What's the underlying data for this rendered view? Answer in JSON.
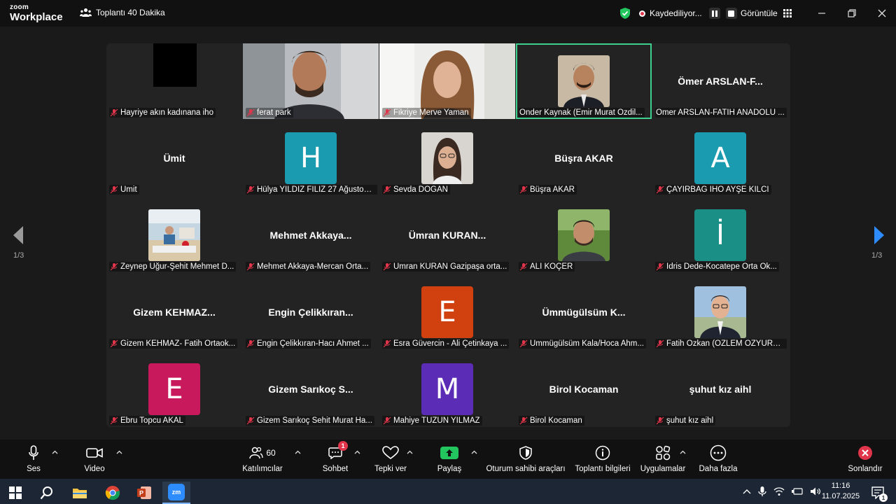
{
  "app": {
    "logo_line1": "zoom",
    "logo_line2": "Workplace",
    "meeting_title": "Toplantı 40 Dakika"
  },
  "header": {
    "recording_label": "Kaydediliyor...",
    "view_label": "Görüntüle"
  },
  "navigation": {
    "page_left": "1/3",
    "page_right": "1/3"
  },
  "tiles": [
    {
      "display": "",
      "label": "Hayriye akın kadınana iho"
    },
    {
      "display": "",
      "label": "ferat park"
    },
    {
      "display": "",
      "label": "Fikriye Merve Yaman"
    },
    {
      "display": "",
      "label": "Önder Kaynak (Emir Murat Özdil..."
    },
    {
      "display": "Ömer ARSLAN-F...",
      "label": "Ömer ARSLAN-FATİH ANADOLU ..."
    },
    {
      "display": "Ümit",
      "label": "Ümit"
    },
    {
      "display": "H",
      "label": "Hülya YILDIZ FİLİZ 27 Ağustos ..."
    },
    {
      "display": "",
      "label": "Sevda DOĞAN"
    },
    {
      "display": "Büşra AKAR",
      "label": "Büşra AKAR"
    },
    {
      "display": "A",
      "label": "ÇAYIRBAĞ İHO AYŞE KILCI"
    },
    {
      "display": "",
      "label": "Zeynep Uğur-Şehit Mehmet D..."
    },
    {
      "display": "Mehmet  Akkaya...",
      "label": "Mehmet Akkaya-Mercan Orta..."
    },
    {
      "display": "Ümran  KURAN...",
      "label": "Ümran KURAN Gazipaşa orta..."
    },
    {
      "display": "",
      "label": "ALİ KOÇER"
    },
    {
      "display": "İ",
      "label": "İdris Dede-Kocatepe Orta Ok..."
    },
    {
      "display": "Gizem  KEHMAZ...",
      "label": "Gizem KEHMAZ- Fatih Ortaok..."
    },
    {
      "display": "Engin  Çelikkıran...",
      "label": "Engin Çelikkıran-Hacı Ahmet ..."
    },
    {
      "display": "E",
      "label": "Esra Güvercin - Ali Çetinkaya ..."
    },
    {
      "display": "Ümmügülsüm  K...",
      "label": "Ümmügülsüm Kala/Hoca Ahm..."
    },
    {
      "display": "",
      "label": "Fatih Özkan (ÖZLEM ÖZYURT ..."
    },
    {
      "display": "E",
      "label": "Ebru Topcu AKAL"
    },
    {
      "display": "Gizem  Sarıkoç  S...",
      "label": "Gizem Sarıkoç Sehit Murat Ha..."
    },
    {
      "display": "M",
      "label": "Mahiye TÜZÜN YILMAZ"
    },
    {
      "display": "Birol Kocaman",
      "label": "Birol Kocaman"
    },
    {
      "display": "şuhut kız aihl",
      "label": "şuhut kız aihl"
    }
  ],
  "avatar_colors": {
    "H": "#1a9bb0",
    "A": "#1a9bb0",
    "I": "#1a8f86",
    "E_orange": "#d1410f",
    "E_pink": "#c8195c",
    "M": "#5b2cb5"
  },
  "toolbar": {
    "audio_label": "Ses",
    "video_label": "Video",
    "participants_label": "Katılımcılar",
    "participants_count": "60",
    "chat_label": "Sohbet",
    "chat_badge": "1",
    "reactions_label": "Tepki ver",
    "share_label": "Paylaş",
    "host_tools_label": "Oturum sahibi araçları",
    "meeting_info_label": "Toplantı bilgileri",
    "apps_label": "Uygulamalar",
    "more_label": "Daha fazla",
    "end_label": "Sonlandır"
  },
  "taskbar": {
    "time": "11:16",
    "date": "11.07.2025",
    "notification_count": "1",
    "zoom_app": "zm"
  }
}
